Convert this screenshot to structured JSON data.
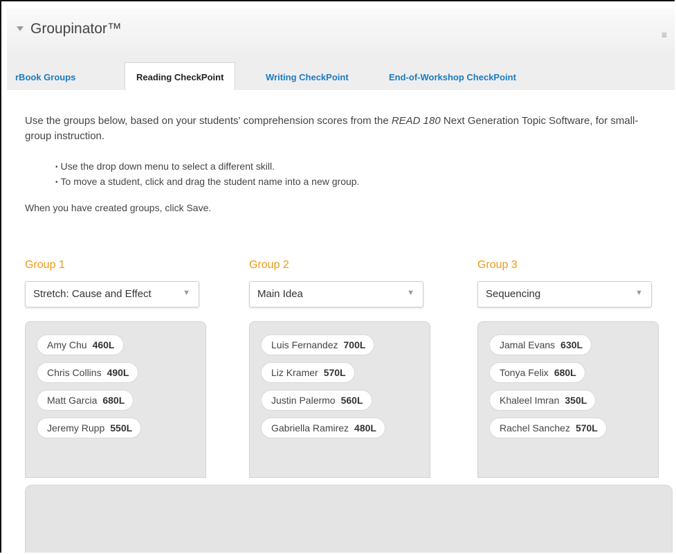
{
  "header": {
    "title": "Groupinator™",
    "menu_glyph": "≡"
  },
  "tabs": [
    {
      "label": "rBook Groups",
      "active": false
    },
    {
      "label": "Reading CheckPoint",
      "active": true
    },
    {
      "label": "Writing CheckPoint",
      "active": false
    },
    {
      "label": "End-of-Workshop CheckPoint",
      "active": false
    }
  ],
  "intro": {
    "text_before": "Use the groups below, based on your students' comprehension scores from the ",
    "text_em": "READ 180",
    "text_after": " Next Generation Topic Software, for small-group instruction."
  },
  "bullets": [
    "Use the drop down menu to select a different skill.",
    "To move a student, click and drag the student name into a new group."
  ],
  "save_note": "When you have created groups, click Save.",
  "groups": [
    {
      "title": "Group 1",
      "skill": "Stretch: Cause and Effect",
      "students": [
        {
          "name": "Amy Chu",
          "score": "460L"
        },
        {
          "name": "Chris Collins",
          "score": "490L"
        },
        {
          "name": "Matt Garcia",
          "score": "680L"
        },
        {
          "name": "Jeremy Rupp",
          "score": "550L"
        }
      ]
    },
    {
      "title": "Group 2",
      "skill": "Main Idea",
      "students": [
        {
          "name": "Luis Fernandez",
          "score": "700L"
        },
        {
          "name": "Liz Kramer",
          "score": "570L"
        },
        {
          "name": "Justin Palermo",
          "score": "560L"
        },
        {
          "name": "Gabriella Ramirez",
          "score": "480L"
        }
      ]
    },
    {
      "title": "Group 3",
      "skill": "Sequencing",
      "students": [
        {
          "name": "Jamal Evans",
          "score": "630L"
        },
        {
          "name": "Tonya Felix",
          "score": "680L"
        },
        {
          "name": "Khaleel Imran",
          "score": "350L"
        },
        {
          "name": "Rachel Sanchez",
          "score": "570L"
        }
      ]
    }
  ],
  "colors": {
    "accent_orange": "#e89a1a",
    "tab_link_blue": "#1a7bc4"
  },
  "icons": {
    "collapse": "collapse-triangle-icon",
    "menu": "menu-icon",
    "dropdown": "chevron-down-icon"
  }
}
